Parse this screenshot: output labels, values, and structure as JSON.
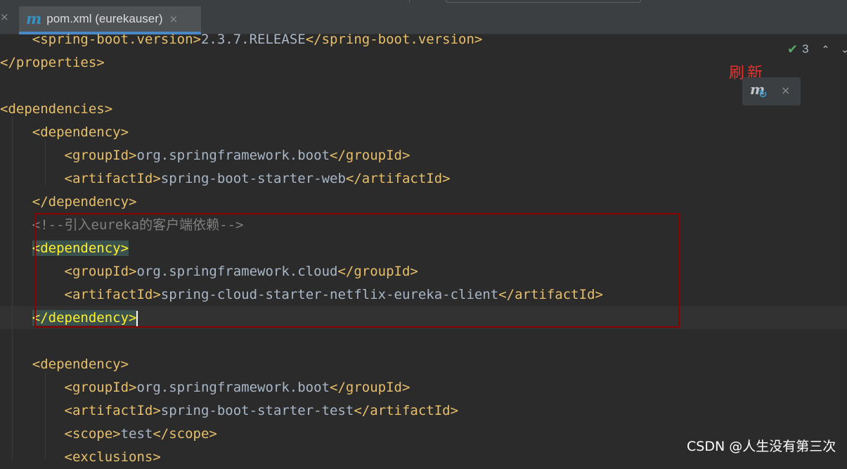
{
  "tab": {
    "close_left": "×",
    "icon": "m",
    "label": "pom.xml (eurekauser)",
    "close": "×"
  },
  "inspection": {
    "check_icon": "✔",
    "count": "3",
    "up_icon": "⌃",
    "down_icon": "⌄"
  },
  "annotation": "刷新",
  "maven_popup": {
    "icon_letter": "m",
    "reload_glyph": "↻",
    "close": "×"
  },
  "code": {
    "l1_open": "<spring-boot.version>",
    "l1_text": "2.3.7.RELEASE",
    "l1_close": "</spring-boot.version>",
    "l2": "</properties>",
    "l4": "<dependencies>",
    "l5": "<dependency>",
    "l6_open": "<groupId>",
    "l6_text": "org.springframework.boot",
    "l6_close": "</groupId>",
    "l7_open": "<artifactId>",
    "l7_text": "spring-boot-starter-web",
    "l7_close": "</artifactId>",
    "l8": "</dependency>",
    "l9_comment": "<!--引入eureka的客户端依赖-->",
    "l10": "<dependency>",
    "l11_open": "<groupId>",
    "l11_text": "org.springframework.cloud",
    "l11_close": "</groupId>",
    "l12_open": "<artifactId>",
    "l12_text": "spring-cloud-starter-netflix-eureka-client",
    "l12_close": "</artifactId>",
    "l13": "</dependency>",
    "l15": "<dependency>",
    "l16_open": "<groupId>",
    "l16_text": "org.springframework.boot",
    "l16_close": "</groupId>",
    "l17_open": "<artifactId>",
    "l17_text": "spring-boot-starter-test",
    "l17_close": "</artifactId>",
    "l18_open": "<scope>",
    "l18_text": "test",
    "l18_close": "</scope>",
    "l19": "<exclusions>"
  },
  "watermark": "CSDN @人生没有第三次",
  "colors": {
    "background": "#2b2b2b",
    "tag": "#e8bf6a",
    "text": "#a9b7c6",
    "comment": "#808080",
    "highlight_border": "#8b0000",
    "annotation": "#e5322d"
  }
}
